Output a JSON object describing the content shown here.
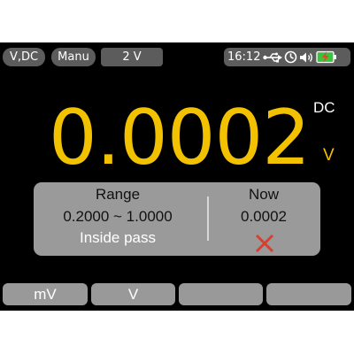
{
  "status_bar": {
    "mode": "V,DC",
    "trigger": "Manu",
    "range": "2 V",
    "time": "16:12",
    "icons": [
      "usb-icon",
      "timer-icon",
      "speaker-icon",
      "battery-charging-icon"
    ]
  },
  "display": {
    "reading": "0.0002",
    "coupling": "DC",
    "unit": "V"
  },
  "comparison": {
    "range_title": "Range",
    "range_values": "0.2000 ~ 1.0000",
    "range_result": "Inside pass",
    "now_title": "Now",
    "now_value": "0.0002",
    "status_icon": "fail-x-icon"
  },
  "softkeys": [
    "mV",
    "V",
    "",
    ""
  ],
  "colors": {
    "reading": "#f2c200",
    "fail": "#d64030",
    "battery": "#3cc23c",
    "panel": "#9a9a9a"
  }
}
